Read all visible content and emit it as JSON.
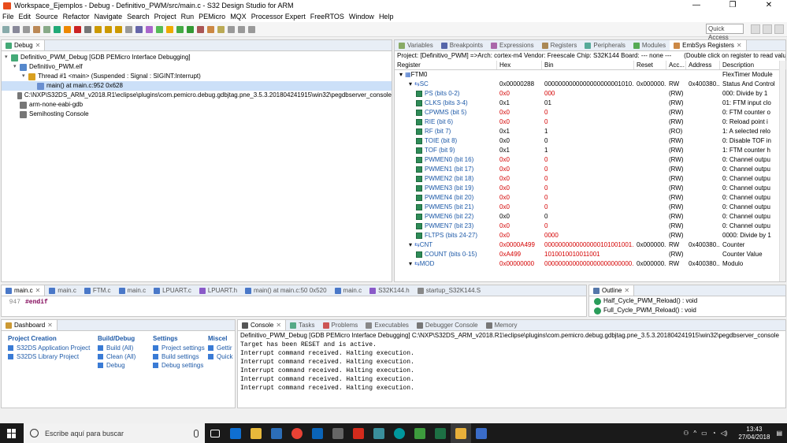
{
  "window": {
    "title": "Workspace_Ejemplos - Debug - Definitivo_PWM/src/main.c - S32 Design Studio for ARM",
    "controls": [
      "—",
      "❐",
      "✕"
    ]
  },
  "menu": [
    "File",
    "Edit",
    "Source",
    "Refactor",
    "Navigate",
    "Search",
    "Project",
    "Run",
    "PEMicro",
    "MQX",
    "Processor Expert",
    "FreeRTOS",
    "Window",
    "Help"
  ],
  "toolbar": {
    "quick_access": "Quick Access"
  },
  "debug_view": {
    "tab": "Debug",
    "tree": [
      {
        "label": "Definitivo_PWM_Debug [GDB PEMicro Interface Debugging]",
        "indent": 0
      },
      {
        "label": "Definitivo_PWM.elf",
        "indent": 1
      },
      {
        "label": "Thread #1 <main> (Suspended : Signal : SIGINT:Interrupt)",
        "indent": 2
      },
      {
        "label": "main() at main.c:952 0x628",
        "indent": 3,
        "selected": true
      },
      {
        "label": "C:\\NXP\\S32DS_ARM_v2018.R1\\eclipse\\plugins\\com.pemicro.debug.gdbjtag.pne_3.5.3.201804241915\\win32\\pegdbserver_console",
        "indent": 1
      },
      {
        "label": "arm-none-eabi-gdb",
        "indent": 1
      },
      {
        "label": "Semihosting Console",
        "indent": 1
      }
    ]
  },
  "right_tabs": [
    "Variables",
    "Breakpoints",
    "Expressions",
    "Registers",
    "Peripherals",
    "Modules",
    "EmbSys Registers"
  ],
  "embsys": {
    "project_line": "Project: [Definitivo_PWM] =>Arch: cortex-m4  Vendor: Freescale  Chip: S32K144  Board: ---  none ---",
    "hint": "(Double click on register to read value",
    "columns": [
      "Register",
      "Hex",
      "Bin",
      "Reset",
      "Acc...",
      "Address",
      "Description"
    ],
    "rows": [
      {
        "reg": "FTM0",
        "hex": "",
        "bin": "",
        "reset": "",
        "acc": "",
        "addr": "",
        "desc": "FlexTimer Module",
        "level": 0,
        "kind": "group"
      },
      {
        "reg": "SC",
        "hex": "0x00000288",
        "bin": "0000000000000000000001010...",
        "reset": "0x000000...",
        "acc": "RW",
        "addr": "0x400380...",
        "desc": "Status And Control",
        "level": 1,
        "kind": "reg"
      },
      {
        "reg": "PS (bits 0-2)",
        "hex": "0x0",
        "bin": "000",
        "reset": "",
        "acc": "(RW)",
        "addr": "",
        "desc": "000: Divide by 1",
        "level": 2,
        "kind": "field",
        "red": true
      },
      {
        "reg": "CLKS (bits 3-4)",
        "hex": "0x1",
        "bin": "01",
        "reset": "",
        "acc": "(RW)",
        "addr": "",
        "desc": "01: FTM input clo",
        "level": 2,
        "kind": "field",
        "red": false
      },
      {
        "reg": "CPWMS (bit 5)",
        "hex": "0x0",
        "bin": "0",
        "reset": "",
        "acc": "(RW)",
        "addr": "",
        "desc": "0: FTM counter o",
        "level": 2,
        "kind": "field",
        "red": true
      },
      {
        "reg": "RIE (bit 6)",
        "hex": "0x0",
        "bin": "0",
        "reset": "",
        "acc": "(RW)",
        "addr": "",
        "desc": "0: Reload point i",
        "level": 2,
        "kind": "field",
        "red": true
      },
      {
        "reg": "RF (bit 7)",
        "hex": "0x1",
        "bin": "1",
        "reset": "",
        "acc": "(RO)",
        "addr": "",
        "desc": "1: A selected relo",
        "level": 2,
        "kind": "field",
        "red": false
      },
      {
        "reg": "TOIE (bit 8)",
        "hex": "0x0",
        "bin": "0",
        "reset": "",
        "acc": "(RW)",
        "addr": "",
        "desc": "0: Disable TOF in",
        "level": 2,
        "kind": "field",
        "red": false
      },
      {
        "reg": "TOF (bit 9)",
        "hex": "0x1",
        "bin": "1",
        "reset": "",
        "acc": "(RW)",
        "addr": "",
        "desc": "1: FTM counter h",
        "level": 2,
        "kind": "field",
        "red": false
      },
      {
        "reg": "PWMEN0 (bit 16)",
        "hex": "0x0",
        "bin": "0",
        "reset": "",
        "acc": "(RW)",
        "addr": "",
        "desc": "0: Channel outpu",
        "level": 2,
        "kind": "field",
        "red": true
      },
      {
        "reg": "PWMEN1 (bit 17)",
        "hex": "0x0",
        "bin": "0",
        "reset": "",
        "acc": "(RW)",
        "addr": "",
        "desc": "0: Channel outpu",
        "level": 2,
        "kind": "field",
        "red": true
      },
      {
        "reg": "PWMEN2 (bit 18)",
        "hex": "0x0",
        "bin": "0",
        "reset": "",
        "acc": "(RW)",
        "addr": "",
        "desc": "0: Channel outpu",
        "level": 2,
        "kind": "field",
        "red": true
      },
      {
        "reg": "PWMEN3 (bit 19)",
        "hex": "0x0",
        "bin": "0",
        "reset": "",
        "acc": "(RW)",
        "addr": "",
        "desc": "0: Channel outpu",
        "level": 2,
        "kind": "field",
        "red": true
      },
      {
        "reg": "PWMEN4 (bit 20)",
        "hex": "0x0",
        "bin": "0",
        "reset": "",
        "acc": "(RW)",
        "addr": "",
        "desc": "0: Channel outpu",
        "level": 2,
        "kind": "field",
        "red": true
      },
      {
        "reg": "PWMEN5 (bit 21)",
        "hex": "0x0",
        "bin": "0",
        "reset": "",
        "acc": "(RW)",
        "addr": "",
        "desc": "0: Channel outpu",
        "level": 2,
        "kind": "field",
        "red": true
      },
      {
        "reg": "PWMEN6 (bit 22)",
        "hex": "0x0",
        "bin": "0",
        "reset": "",
        "acc": "(RW)",
        "addr": "",
        "desc": "0: Channel outpu",
        "level": 2,
        "kind": "field",
        "red": false
      },
      {
        "reg": "PWMEN7 (bit 23)",
        "hex": "0x0",
        "bin": "0",
        "reset": "",
        "acc": "(RW)",
        "addr": "",
        "desc": "0: Channel outpu",
        "level": 2,
        "kind": "field",
        "red": true
      },
      {
        "reg": "FLTPS (bits 24-27)",
        "hex": "0x0",
        "bin": "0000",
        "reset": "",
        "acc": "(RW)",
        "addr": "",
        "desc": "0000: Divide by 1",
        "level": 2,
        "kind": "field",
        "red": true
      },
      {
        "reg": "CNT",
        "hex": "0x0000A499",
        "bin": "0000000000000000101001001...",
        "reset": "0x000000...",
        "acc": "RW",
        "addr": "0x400380...",
        "desc": "Counter",
        "level": 1,
        "kind": "reg",
        "red": true
      },
      {
        "reg": "COUNT (bits 0-15)",
        "hex": "0xA499",
        "bin": "1010010010011001",
        "reset": "",
        "acc": "(RW)",
        "addr": "",
        "desc": "Counter Value",
        "level": 2,
        "kind": "field",
        "red": true
      },
      {
        "reg": "MOD",
        "hex": "0x00000000",
        "bin": "0000000000000000000000000...",
        "reset": "0x000000...",
        "acc": "RW",
        "addr": "0x400380...",
        "desc": "Modulo",
        "level": 1,
        "kind": "reg",
        "red": true
      }
    ]
  },
  "editor": {
    "tabs": [
      "main.c",
      "main.c",
      "FTM.c",
      "main.c",
      "LPUART.c",
      "LPUART.h",
      "main() at main.c:50 0x520",
      "main.c",
      "S32K144.h",
      "startup_S32K144.S"
    ],
    "line_no": "947",
    "line_text": "#endif"
  },
  "outline": {
    "tab": "Outline",
    "items": [
      "Half_Cycle_PWM_Reload() : void",
      "Full_Cycle_PWM_Reload() : void"
    ]
  },
  "dashboard": {
    "tab": "Dashboard",
    "columns": [
      {
        "title": "Project Creation",
        "items": [
          "S32DS Application Project",
          "S32DS Library Project"
        ]
      },
      {
        "title": "Build/Debug",
        "items": [
          "Build  (All)",
          "Clean  (All)",
          "Debug"
        ]
      },
      {
        "title": "Settings",
        "items": [
          "Project settings",
          "Build settings",
          "Debug settings"
        ]
      },
      {
        "title": "Miscel",
        "items": [
          "Gettir",
          "Quick"
        ]
      }
    ]
  },
  "console": {
    "tabs": [
      "Console",
      "Tasks",
      "Problems",
      "Executables",
      "Debugger Console",
      "Memory"
    ],
    "header": "Definitivo_PWM_Debug [GDB PEMicro Interface Debugging] C:\\NXP\\S32DS_ARM_v2018.R1\\eclipse\\plugins\\com.pemicro.debug.gdbjtag.pne_3.5.3.201804241915\\win32\\pegdbserver_console",
    "lines": [
      "Target has been RESET and is active.",
      "Interrupt command received. Halting execution.",
      "Interrupt command received. Halting execution.",
      "Interrupt command received. Halting execution.",
      "Interrupt command received. Halting execution.",
      "Interrupt command received. Halting execution."
    ]
  },
  "taskbar": {
    "search_placeholder": "Escribe aquí para buscar",
    "time": "13:43",
    "date": "27/04/2018"
  }
}
